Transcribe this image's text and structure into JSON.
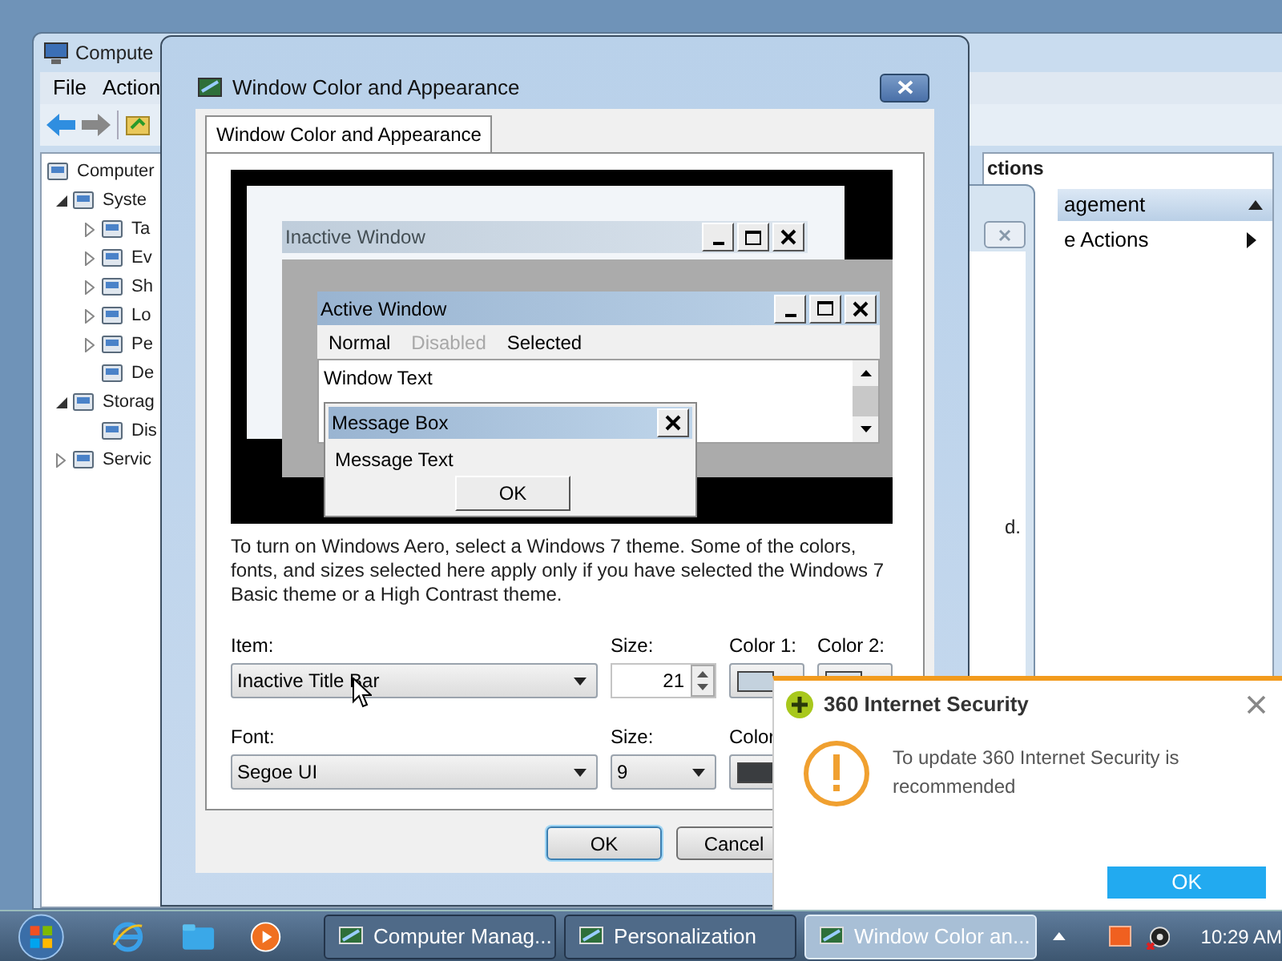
{
  "background_window": {
    "title": "Compute",
    "menu": [
      "File",
      "Action"
    ],
    "tree": [
      {
        "label": "Computer",
        "children": [
          {
            "label": "Syste",
            "expanded": true,
            "children": [
              {
                "label": "Ta",
                "expanded": false
              },
              {
                "label": "Ev",
                "expanded": false
              },
              {
                "label": "Sh",
                "expanded": false
              },
              {
                "label": "Lo",
                "expanded": false
              },
              {
                "label": "Pe",
                "expanded": false
              },
              {
                "label": "De"
              }
            ]
          },
          {
            "label": "Storag",
            "expanded": true,
            "children": [
              {
                "label": "Dis"
              }
            ]
          },
          {
            "label": "Servic",
            "expanded": false
          }
        ]
      }
    ],
    "actions_header": "ctions",
    "actions": [
      {
        "label": "agement",
        "kind": "group"
      },
      {
        "label": "e Actions",
        "kind": "item"
      }
    ],
    "behind_text": "d."
  },
  "dialog": {
    "title": "Window Color and Appearance",
    "tabs": [
      {
        "label": "Window Color and Appearance",
        "selected": true
      }
    ],
    "preview": {
      "inactive_title": "Inactive Window",
      "active_title": "Active Window",
      "menu": [
        {
          "label": "Normal",
          "disabled": false
        },
        {
          "label": "Disabled",
          "disabled": true
        },
        {
          "label": "Selected",
          "disabled": false
        }
      ],
      "window_text": "Window Text",
      "message_title": "Message Box",
      "message_text": "Message Text",
      "message_button": "OK"
    },
    "description": "To turn on Windows Aero, select a Windows 7 theme.  Some of the colors, fonts, and sizes selected here apply only if you have selected the Windows 7 Basic theme or a High Contrast theme.",
    "item_label": "Item:",
    "item_value": "Inactive Title Bar",
    "size_label": "Size:",
    "size_value": "21",
    "color1": {
      "label": "Color 1:",
      "color": "#c4d2de"
    },
    "color2": {
      "label": "Color 2:",
      "color": "#dae4ee"
    },
    "font_label": "Font:",
    "font_value": "Segoe UI",
    "font_size_label": "Size:",
    "font_size_value": "9",
    "font_color": {
      "label": "Color",
      "color": "#3a3d40"
    },
    "buttons": [
      "OK",
      "Cancel"
    ]
  },
  "popup": {
    "title": "360 Internet Security",
    "message": "To update 360 Internet Security is recommended",
    "button": "OK"
  },
  "taskbar": {
    "tasks": [
      {
        "label": "Computer Manag...",
        "selected": false
      },
      {
        "label": "Personalization",
        "selected": false
      },
      {
        "label": "Window Color an...",
        "selected": true
      }
    ],
    "clock": "10:29 AM"
  }
}
